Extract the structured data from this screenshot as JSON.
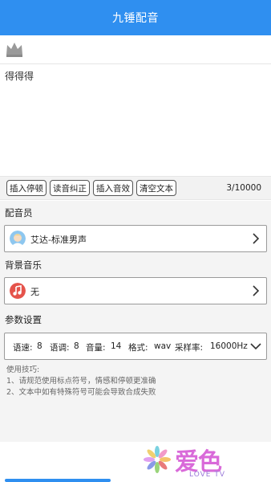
{
  "header": {
    "title": "九锤配音"
  },
  "editor": {
    "text": "得得得",
    "counter": "3/10000"
  },
  "tools": {
    "insert_pause": "插入停顿",
    "pronunciation": "读音纠正",
    "insert_effect": "插入音效",
    "clear_text": "清空文本"
  },
  "voice": {
    "section_label": "配音员",
    "selected": "艾达-标准男声"
  },
  "music": {
    "section_label": "背景音乐",
    "selected": "无"
  },
  "params": {
    "section_label": "参数设置",
    "speed_label": "语速:",
    "speed": "8",
    "pitch_label": "语调:",
    "pitch": "8",
    "volume_label": "音量:",
    "volume": "14",
    "format_label": "格式:",
    "format": "wav",
    "rate_label": "采样率:",
    "rate": "16000Hz"
  },
  "tips": {
    "title": "使用技巧:",
    "line1": "1、请规范使用标点符号，情感和停顿更准确",
    "line2": "2、文本中如有特殊符号可能会导致合成失败"
  },
  "watermark": {
    "main": "爱色",
    "sub": "LOVE TV"
  },
  "colors": {
    "accent": "#2f8ff0",
    "music_icon": "#e5534b",
    "watermark": "#d96ad9"
  }
}
